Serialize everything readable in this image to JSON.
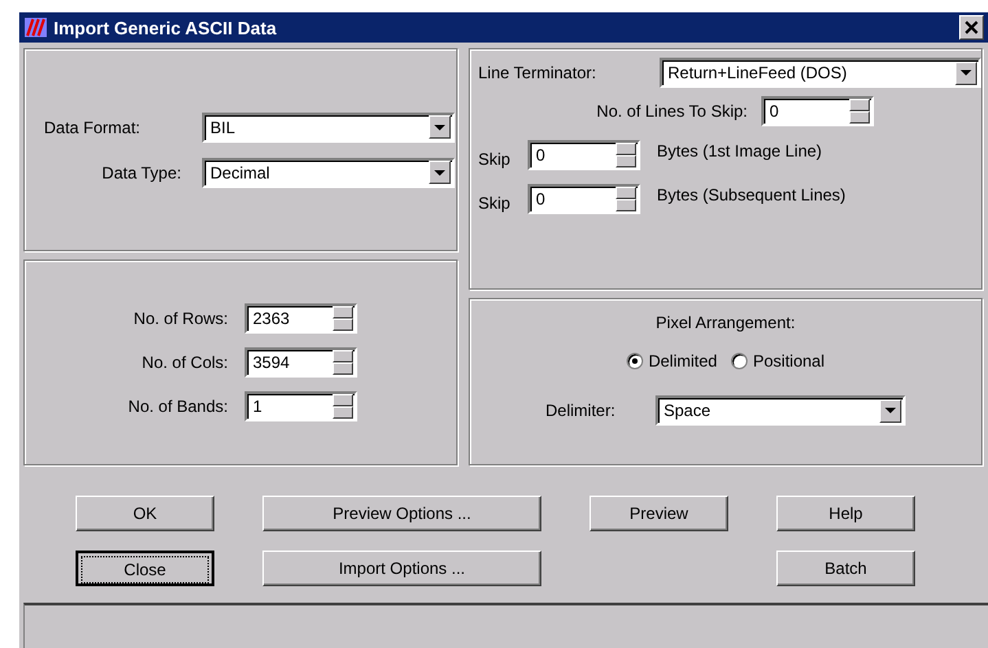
{
  "window": {
    "title": "Import Generic ASCII Data"
  },
  "format_panel": {
    "dropdowns": [
      {
        "label": "Data Format:",
        "value": "BIL"
      },
      {
        "label": "Data Type:",
        "value": "Decimal"
      }
    ]
  },
  "size_panel": {
    "spinners": [
      {
        "label": "No. of Rows:",
        "value": "2363"
      },
      {
        "label": "No. of Cols:",
        "value": "3594"
      },
      {
        "label": "No. of Bands:",
        "value": "1"
      }
    ]
  },
  "line_panel": {
    "terminator": {
      "label": "Line Terminator:",
      "value": "Return+LineFeed (DOS)"
    },
    "lines_to_skip": {
      "label": "No. of Lines To Skip:",
      "value": "0"
    },
    "byte_skips": [
      {
        "label": "Skip",
        "value": "0",
        "note": "Bytes (1st Image Line)"
      },
      {
        "label": "Skip",
        "value": "0",
        "note": "Bytes (Subsequent Lines)"
      }
    ]
  },
  "pixel_panel": {
    "title": "Pixel Arrangement:",
    "options": [
      {
        "label": "Delimited",
        "selected": true
      },
      {
        "label": "Positional",
        "selected": false
      }
    ],
    "delimiter": {
      "label": "Delimiter:",
      "value": "Space"
    }
  },
  "buttons": [
    [
      {
        "label": "OK",
        "focused": false
      },
      {
        "label": "Preview Options ...",
        "focused": false
      },
      {
        "label": "Preview",
        "focused": false
      },
      {
        "label": "Help",
        "focused": false
      }
    ],
    [
      {
        "label": "Close",
        "focused": true
      },
      {
        "label": "Import Options ...",
        "focused": false
      },
      {
        "label": "Batch",
        "focused": false
      }
    ]
  ]
}
